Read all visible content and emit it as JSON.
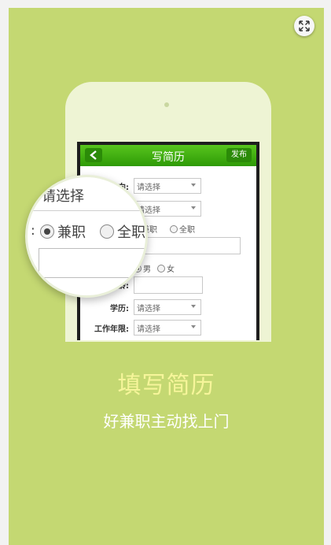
{
  "expand_icon": "expand-arrows-icon",
  "app": {
    "title": "写简历",
    "back_icon": "chevron-left-icon",
    "publish_label": "发布",
    "form": {
      "intent_label": "意向:",
      "select_placeholder": "请选择",
      "type_part_time": "兼职",
      "type_full_time": "全职",
      "gender_male": "男",
      "gender_female": "女",
      "age_label": "年龄:",
      "education_label": "学历:",
      "experience_label": "工作年限:"
    }
  },
  "magnifier": {
    "select_text": "请选择",
    "colon": ":",
    "part_time": "兼职",
    "full_time": "全职"
  },
  "promo": {
    "headline": "填写简历",
    "subline": "好兼职主动找上门"
  },
  "colors": {
    "background": "#c4d872",
    "navbar": "#3fae10",
    "headline": "#f6f59a"
  }
}
